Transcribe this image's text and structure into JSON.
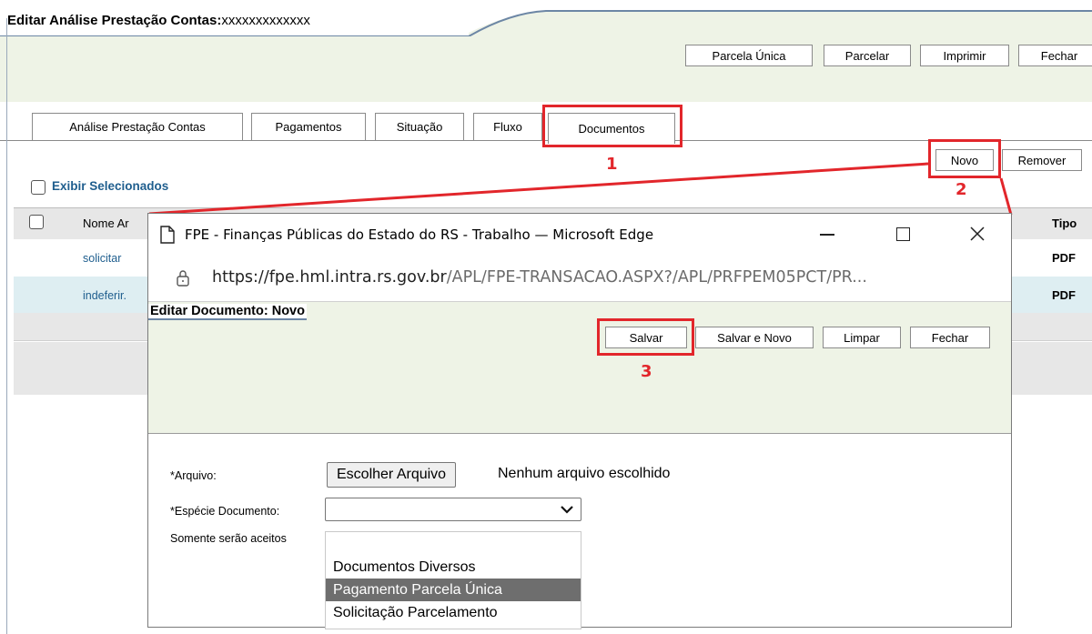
{
  "page": {
    "title": "Editar Análise Prestação Contas:",
    "title_value": "xxxxxxxxxxxxx",
    "toolbar": [
      "Parcela Única",
      "Parcelar",
      "Imprimir",
      "Fechar"
    ],
    "tabs": [
      "Análise Prestação Contas",
      "Pagamentos",
      "Situação",
      "Fluxo",
      "Documentos"
    ],
    "novo_label": "Novo",
    "remover_label": "Remover",
    "exibir_label": "Exibir Selecionados",
    "col_nome": "Nome Ar",
    "col_tipo": "Tipo",
    "rows": [
      {
        "nome": "solicitar",
        "tipo": "PDF"
      },
      {
        "nome": "indeferir.",
        "tipo": "PDF"
      }
    ]
  },
  "popup": {
    "window_title": "FPE - Finanças Públicas do Estado do RS - Trabalho — Microsoft Edge",
    "url_host": "https://fpe.hml.intra.rs.gov.br",
    "url_path": "/APL/FPE-TRANSACAO.ASPX?/APL/PRFPEM05PCT/PR...",
    "heading": "Editar Documento: Novo",
    "buttons": [
      "Salvar",
      "Salvar e Novo",
      "Limpar",
      "Fechar"
    ],
    "arquivo_label": "*Arquivo:",
    "choose_file": "Escolher Arquivo",
    "no_file": "Nenhum arquivo escolhido",
    "especie_label": "*Espécie Documento:",
    "especie_value": "",
    "note": "Somente serão aceitos",
    "options": [
      "Documentos Diversos",
      "Pagamento Parcela Única",
      "Solicitação Parcelamento"
    ],
    "highlighted_option": "Pagamento Parcela Única"
  },
  "annotations": [
    "1",
    "2",
    "3"
  ],
  "colors": {
    "panel_green": "#eef3e6",
    "link_blue": "#1f5e8e",
    "highlight_red": "#e2262b",
    "row_blue": "#deeef2",
    "grey_band": "#e7e7e7"
  }
}
